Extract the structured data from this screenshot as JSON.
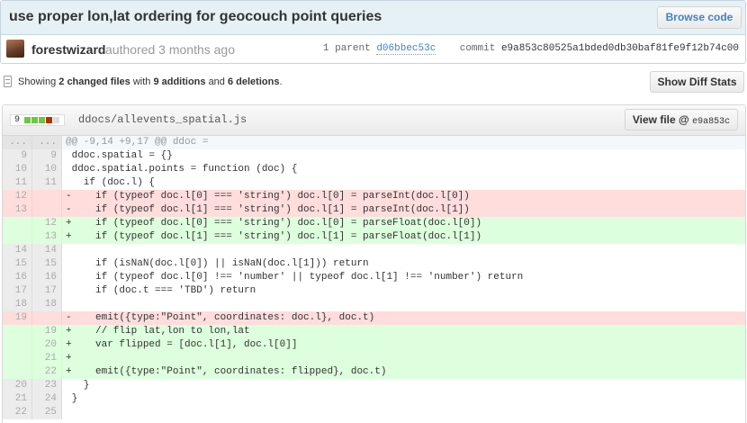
{
  "commit": {
    "title": "use proper lon,lat ordering for geocouch point queries",
    "browse_label": "Browse code",
    "author": "forestwizard",
    "authored_text": "authored 3 months ago",
    "parent_count_label": "1 parent",
    "parent_sha": "d06bbec53c",
    "commit_label": "commit",
    "commit_sha": "e9a853c80525a1bded0db30baf81fe9f12b74c00"
  },
  "toc": {
    "showing": "Showing",
    "changed_files": "2 changed files",
    "with": "with",
    "additions": "9 additions",
    "and": "and",
    "deletions": "6 deletions",
    "period": ".",
    "diff_stats_label": "Show Diff Stats"
  },
  "file": {
    "diffstat_count": "9",
    "diffstat_blocks": [
      "#6cc644",
      "#6cc644",
      "#6cc644",
      "#bd2c00",
      "#dddddd"
    ],
    "name": "ddocs/allevents_spatial.js",
    "view_label": "View file @",
    "view_sha": "e9a853c"
  },
  "lines": [
    {
      "type": "hunk",
      "old": "...",
      "new": "...",
      "code": "@@ -9,14 +9,17 @@ ddoc ="
    },
    {
      "type": "ctx",
      "old": "9",
      "new": "9",
      "code": " ddoc.spatial = {}"
    },
    {
      "type": "ctx",
      "old": "10",
      "new": "10",
      "code": " ddoc.spatial.points = function (doc) {"
    },
    {
      "type": "ctx",
      "old": "11",
      "new": "11",
      "code": "   if (doc.l) {"
    },
    {
      "type": "del",
      "old": "12",
      "new": "",
      "code": "-    if (typeof doc.l[0] === 'string') doc.l[0] = parseInt(doc.l[0])"
    },
    {
      "type": "del",
      "old": "13",
      "new": "",
      "code": "-    if (typeof doc.l[1] === 'string') doc.l[1] = parseInt(doc.l[1])"
    },
    {
      "type": "add",
      "old": "",
      "new": "12",
      "code": "+    if (typeof doc.l[0] === 'string') doc.l[0] = parseFloat(doc.l[0])"
    },
    {
      "type": "add",
      "old": "",
      "new": "13",
      "code": "+    if (typeof doc.l[1] === 'string') doc.l[1] = parseFloat(doc.l[1])"
    },
    {
      "type": "ctx",
      "old": "14",
      "new": "14",
      "code": ""
    },
    {
      "type": "ctx",
      "old": "15",
      "new": "15",
      "code": "     if (isNaN(doc.l[0]) || isNaN(doc.l[1])) return"
    },
    {
      "type": "ctx",
      "old": "16",
      "new": "16",
      "code": "     if (typeof doc.l[0] !== 'number' || typeof doc.l[1] !== 'number') return"
    },
    {
      "type": "ctx",
      "old": "17",
      "new": "17",
      "code": "     if (doc.t === 'TBD') return"
    },
    {
      "type": "ctx",
      "old": "18",
      "new": "18",
      "code": ""
    },
    {
      "type": "del",
      "old": "19",
      "new": "",
      "code": "-    emit({type:\"Point\", coordinates: doc.l}, doc.t)"
    },
    {
      "type": "add",
      "old": "",
      "new": "19",
      "code": "+    // flip lat,lon to lon,lat"
    },
    {
      "type": "add",
      "old": "",
      "new": "20",
      "code": "+    var flipped = [doc.l[1], doc.l[0]]"
    },
    {
      "type": "add",
      "old": "",
      "new": "21",
      "code": "+"
    },
    {
      "type": "add",
      "old": "",
      "new": "22",
      "code": "+    emit({type:\"Point\", coordinates: flipped}, doc.t)"
    },
    {
      "type": "ctx",
      "old": "20",
      "new": "23",
      "code": "   }"
    },
    {
      "type": "ctx",
      "old": "21",
      "new": "24",
      "code": " }"
    },
    {
      "type": "ctx",
      "old": "22",
      "new": "25",
      "code": ""
    }
  ]
}
